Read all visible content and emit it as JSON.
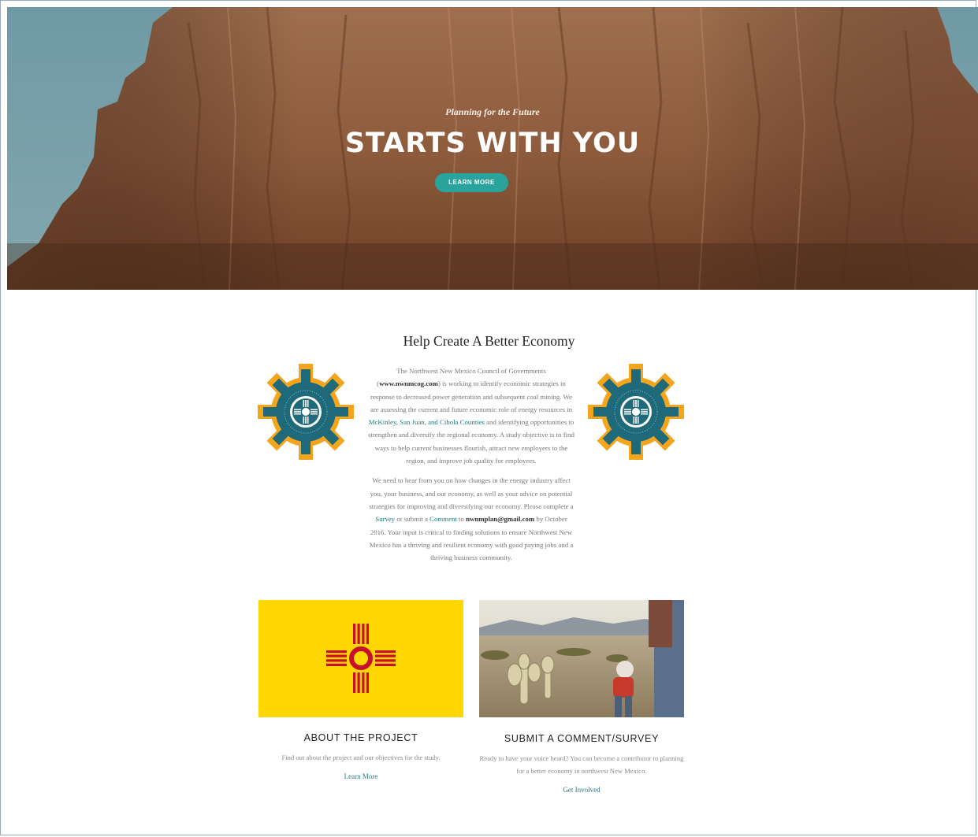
{
  "hero": {
    "tagline": "Planning for the Future",
    "title": "STARTS WITH YOU",
    "button_label": "LEARN MORE"
  },
  "intro": {
    "title": "Help Create A Better Economy",
    "p1": {
      "t1": "The Northwest New Mexico Council of Governments (",
      "link_site": "www.nwnmcog.com",
      "t2": ") is working to identify economic strategies in response to decreased power generation and subsequent coal mining. We are assessing the current and future economic role of energy resources in ",
      "link_counties": "McKinley, San Juan, and Cibola Counties",
      "t3": " and identifying opportunities to strengthen and diversify the regional economy. A study objective is to find ways to help current businesses flourish, attract new employers to the region, and improve job quality for employees."
    },
    "p2": {
      "t1": "We need to hear from you on how changes in the energy industry affect you, your business, and our economy, as well as your advice on potential strategies for improving and diversifying our economy. Please complete a ",
      "link_survey": "Survey",
      "t2": " or submit a ",
      "link_comment": "Comment",
      "t3": " to ",
      "email": "nwnmplan@gmail.com",
      "t4": " by October 2016. Your input is critical to finding solutions to ensure Northwest New Mexico has a thriving and resilient economy with good paying jobs and a thriving business community."
    }
  },
  "cards": [
    {
      "title": "ABOUT THE PROJECT",
      "desc": "Find out about the project and our objectives for the study.",
      "link": "Learn More"
    },
    {
      "title": "SUBMIT A COMMENT/SURVEY",
      "desc": "Ready to have your voice heard? You can become a contributor to planning for a better economy in northwest New Mexico.",
      "link": "Get Involved"
    }
  ],
  "colors": {
    "accent": "#2aa39c",
    "flag_yellow": "#ffd600",
    "zia_red": "#c8102e",
    "gear_orange": "#f5a51c",
    "gear_teal": "#1f6a7a"
  },
  "icons": [
    "zia-gear-logo-icon",
    "new-mexico-flag-icon"
  ]
}
